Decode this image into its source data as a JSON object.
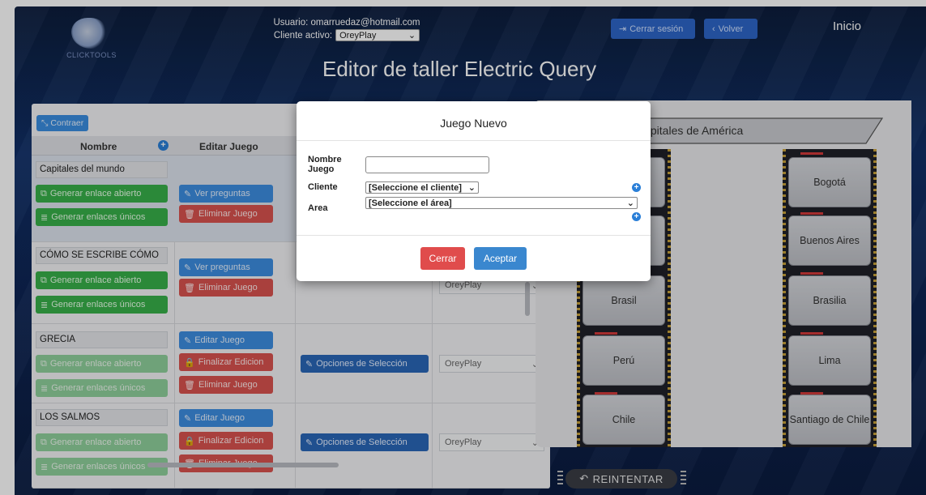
{
  "header": {
    "logo_text": "CLICKTOOLS",
    "user_label": "Usuario: omarruedaz@hotmail.com",
    "client_label": "Cliente activo:",
    "client_value": "OreyPlay",
    "title": "Editor de taller Electric Query",
    "logout_label": "Cerrar sesión",
    "back_label": "Volver",
    "home_label": "Inicio"
  },
  "left": {
    "collapse_label": "Contraer",
    "columns": {
      "name": "Nombre",
      "edit": "Editar Juego"
    },
    "games": [
      {
        "name": "Capitales del mundo",
        "open_link": "Generar enlace abierto",
        "unique_links": "Generar enlaces únicos",
        "btn1": "Ver preguntas",
        "btn2": "Eliminar Juego"
      },
      {
        "name": "CÓMO SE ESCRIBE CÓMO",
        "open_link": "Generar enlace abierto",
        "unique_links": "Generar enlaces únicos",
        "btn1": "Ver preguntas",
        "btn2": "Eliminar Juego",
        "client": "OreyPlay"
      },
      {
        "name": "GRECIA",
        "open_link": "Generar enlace abierto",
        "unique_links": "Generar enlaces únicos",
        "btn1": "Editar Juego",
        "btn2": "Finalizar Edicion",
        "btn3": "Eliminar Juego",
        "options": "Opciones de Selección",
        "client": "OreyPlay"
      },
      {
        "name": "LOS SALMOS",
        "open_link": "Generar enlace abierto",
        "unique_links": "Generar enlaces únicos",
        "btn1": "Editar Juego",
        "btn2": "Finalizar Edicion",
        "btn3": "Eliminar Juego",
        "options": "Opciones de Selección",
        "client": "OreyPlay"
      }
    ]
  },
  "right": {
    "title": "Capitales de América",
    "left_cards": [
      "",
      "",
      "Brasil",
      "Perú",
      "Chile"
    ],
    "right_cards": [
      "Bogotá",
      "Buenos Aires",
      "Brasilia",
      "Lima",
      "Santiago de Chile"
    ],
    "retry_label": "REINTENTAR"
  },
  "modal": {
    "title": "Juego Nuevo",
    "name_label_1": "Nombre",
    "name_label_2": "Juego",
    "client_label": "Cliente",
    "area_label": "Area",
    "client_select": "[Seleccione el cliente]",
    "area_select": "[Seleccione el área]",
    "close_label": "Cerrar",
    "accept_label": "Aceptar"
  },
  "colors": {
    "red": "#e04c4c",
    "blue": "#3a87cf",
    "green": "#38b04a"
  }
}
